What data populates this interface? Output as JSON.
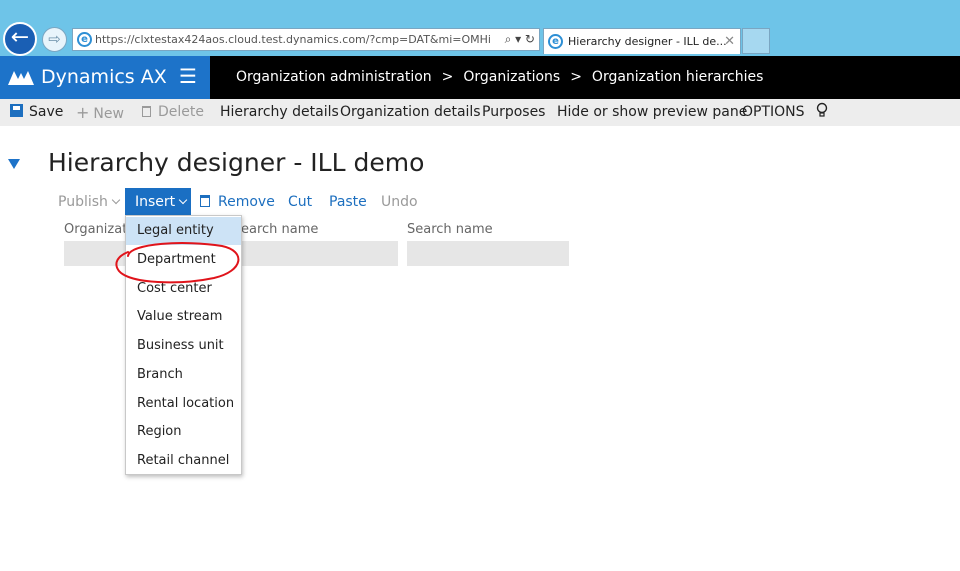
{
  "browser": {
    "url": "https://clxtestax424aos.cloud.test.dynamics.com/?cmp=DAT&mi=OMHi",
    "tab_title": "Hierarchy designer - ILL de...",
    "addr_tools": "⌕ ▾ ↻",
    "tab_close": "✕"
  },
  "app": {
    "brand": "Dynamics AX",
    "menu_icon": "☰",
    "breadcrumbs": [
      "Organization administration",
      "Organizations",
      "Organization hierarchies"
    ],
    "crumb_separator": ">"
  },
  "actionpane": {
    "save": "Save",
    "new": "New",
    "delete": "Delete",
    "hierarchy_details": "Hierarchy details",
    "organization_details": "Organization details",
    "purposes": "Purposes",
    "hide_preview": "Hide or show preview pane",
    "options": "OPTIONS",
    "lightbulb_icon": "lightbulb-icon"
  },
  "page": {
    "title": "Hierarchy designer - ILL demo"
  },
  "toolbar": {
    "publish": "Publish",
    "insert": "Insert",
    "remove": "Remove",
    "cut": "Cut",
    "paste": "Paste",
    "undo": "Undo"
  },
  "fields": {
    "organization_label": "Organizati",
    "search_name_label_1": "earch name",
    "search_name_label_2": "Search name"
  },
  "insert_menu": {
    "items": [
      "Legal entity",
      "Department",
      "Cost center",
      "Value stream",
      "Business unit",
      "Branch",
      "Rental location",
      "Region",
      "Retail channel"
    ],
    "selected_index": 0
  },
  "colors": {
    "brand_blue": "#1d73c9",
    "link_blue": "#1d6fbf",
    "annotation_red": "#e0141b"
  }
}
